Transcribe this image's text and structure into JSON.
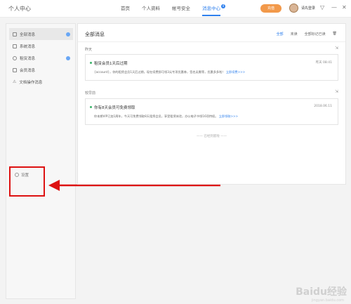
{
  "app": {
    "title": "个人中心"
  },
  "nav": {
    "items": [
      {
        "label": "首页",
        "active": false
      },
      {
        "label": "个人资料",
        "active": false
      },
      {
        "label": "帐号安全",
        "active": false
      },
      {
        "label": "消息中心",
        "active": true,
        "badge": "4"
      }
    ]
  },
  "header": {
    "vip_label": "充值",
    "username": "请先登录",
    "controls": {
      "skin": "▽",
      "minimize": "—",
      "close": "✕"
    }
  },
  "sidebar": {
    "items": [
      {
        "label": "全部消息",
        "icon": "message-icon",
        "badge": true,
        "active": true
      },
      {
        "label": "系统消息",
        "icon": "system-icon",
        "badge": false,
        "active": false
      },
      {
        "label": "租赁消息",
        "icon": "lease-icon",
        "badge": true,
        "active": false
      },
      {
        "label": "会员消息",
        "icon": "member-icon",
        "badge": false,
        "active": false
      },
      {
        "label": "文档操作消息",
        "icon": "warning-icon",
        "badge": false,
        "active": false
      }
    ],
    "settings_label": "设置"
  },
  "main": {
    "title": "全部消息",
    "filters": [
      "全部",
      "未读",
      "全部标记已读"
    ],
    "groups": [
      {
        "label": "昨天",
        "card": {
          "title": "租赁会员1天后过期",
          "time": "昨天 08:41",
          "body": "{account}，你的租赁会员1天后过期，现在续费即可领3元专项优惠券，签也无需等，优惠多多啦！",
          "link": "立即续费>>>"
        }
      },
      {
        "label": "较早前",
        "card": {
          "title": "你有8天会员可免费领取",
          "time": "2018.06.11",
          "body": "你本期VIP已加1周年，今天可免费领取8天租赁会员，享受租赁体验，办公电子书领16项特权。",
          "link": "立即领取>>>"
        }
      }
    ],
    "end_text": "—— 已经到底啦 ——"
  },
  "watermark": {
    "text": "Baidu经验",
    "sub": "jingyan.baidu.com"
  },
  "colors": {
    "accent": "#2f80ed",
    "vip": "#f2994a",
    "highlight": "#dd1111"
  }
}
